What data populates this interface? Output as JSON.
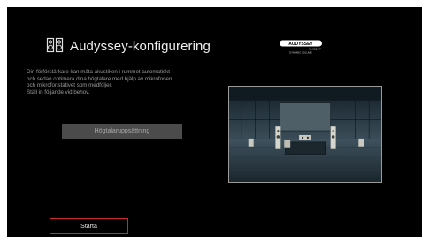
{
  "header": {
    "title": "Audyssey-konfigurering",
    "icon": "speaker-setup-icon"
  },
  "logo": {
    "brand": "AUDYSSEY",
    "line1": "MultEQ XT",
    "line2": "DYNAMIC VOLUME"
  },
  "description": {
    "lines": [
      "Din förförstärkare kan mäta akustiken i rummet automatiskt",
      "och sedan optimera dina högtalare med hjälp av mikrofonen",
      "och mikrofonstativet som medföljer.",
      "Ställ in följande vid behov."
    ]
  },
  "buttons": {
    "speaker_setup": "Högtalaruppsättning",
    "start": "Starta"
  },
  "colors": {
    "background": "#000000",
    "accent": "#c8292e",
    "button_gray": "#4b4b4b"
  }
}
